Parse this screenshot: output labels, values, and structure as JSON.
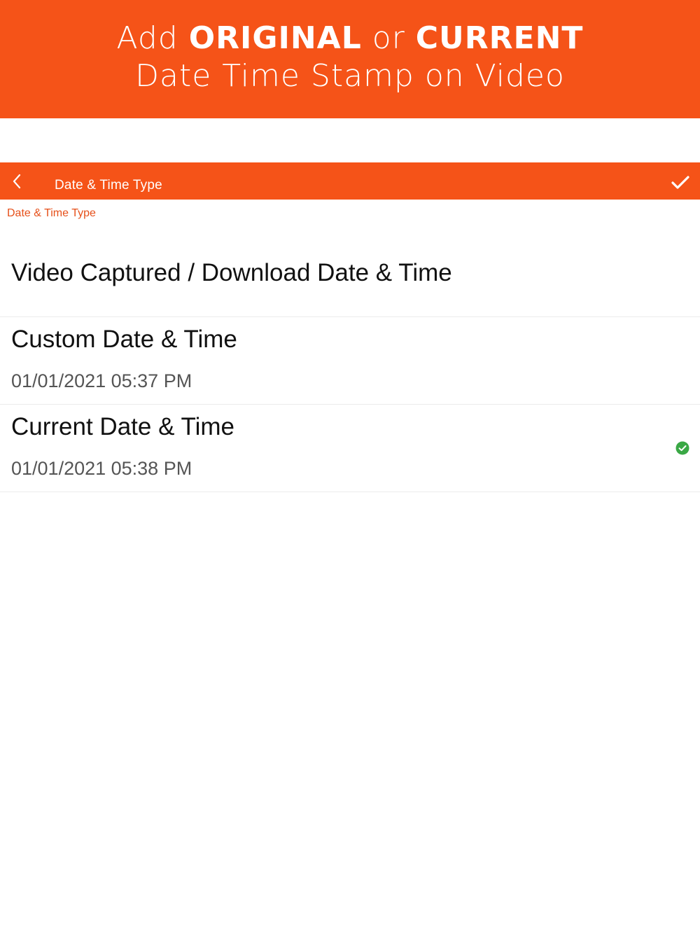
{
  "promo": {
    "line1_prefix": "Add ",
    "line1_original": "ORIGINAL",
    "line1_or": " or ",
    "line1_current": "CURRENT",
    "line2": "Date Time Stamp on Video"
  },
  "navbar": {
    "title": "Date & Time Type",
    "back_icon": "chevron-left-icon",
    "confirm_icon": "checkmark-icon"
  },
  "section": {
    "header": "Date & Time Type"
  },
  "options": [
    {
      "title": "Video Captured / Download Date & Time",
      "subtitle": "",
      "selected": false
    },
    {
      "title": "Custom Date & Time",
      "subtitle": "01/01/2021 05:37 PM",
      "selected": false
    },
    {
      "title": "Current Date & Time",
      "subtitle": "01/01/2021 05:38 PM",
      "selected": true
    }
  ],
  "colors": {
    "accent": "#f55318",
    "section_header": "#e6501a",
    "selected_check": "#3aa845"
  }
}
